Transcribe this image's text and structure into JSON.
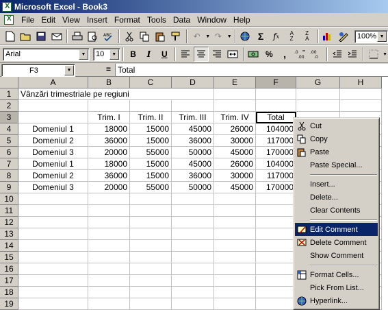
{
  "window": {
    "title": "Microsoft Excel - Book3"
  },
  "menubar": {
    "items": [
      "File",
      "Edit",
      "View",
      "Insert",
      "Format",
      "Tools",
      "Data",
      "Window",
      "Help"
    ]
  },
  "toolbar1": {
    "zoom": "100%"
  },
  "toolbar2": {
    "font": "Arial",
    "size": "10",
    "bold": "B",
    "italic": "I",
    "underline": "U",
    "percent": "%",
    "comma": ","
  },
  "formulabar": {
    "namebox": "F3",
    "equals": "=",
    "content": "Total"
  },
  "sheet": {
    "columns": [
      "A",
      "B",
      "C",
      "D",
      "E",
      "F",
      "G",
      "H"
    ],
    "rows": [
      "1",
      "2",
      "3",
      "4",
      "5",
      "6",
      "7",
      "8",
      "9",
      "10",
      "11",
      "12",
      "13",
      "14",
      "15",
      "16",
      "17",
      "18",
      "19"
    ],
    "title": "Vânzări trimestriale pe regiuni",
    "headers": [
      "Trim. I",
      "Trim. II",
      "Trim. III",
      "Trim. IV",
      "Total"
    ],
    "data": [
      [
        "Domeniul 1",
        "18000",
        "15000",
        "45000",
        "26000",
        "104000"
      ],
      [
        "Domeniul 2",
        "36000",
        "15000",
        "36000",
        "30000",
        "117000"
      ],
      [
        "Domeniul 3",
        "20000",
        "55000",
        "50000",
        "45000",
        "170000"
      ],
      [
        "Domeniul 1",
        "18000",
        "15000",
        "45000",
        "26000",
        "104000"
      ],
      [
        "Domeniul 2",
        "36000",
        "15000",
        "36000",
        "30000",
        "117000"
      ],
      [
        "Domeniul 3",
        "20000",
        "55000",
        "50000",
        "45000",
        "170000"
      ]
    ]
  },
  "context_menu": {
    "cut": "Cut",
    "copy": "Copy",
    "paste": "Paste",
    "paste_special": "Paste Special...",
    "insert": "Insert...",
    "delete": "Delete...",
    "clear_contents": "Clear Contents",
    "edit_comment": "Edit Comment",
    "delete_comment": "Delete Comment",
    "show_comment": "Show Comment",
    "format_cells": "Format Cells...",
    "pick_from_list": "Pick From List...",
    "hyperlink": "Hyperlink..."
  }
}
